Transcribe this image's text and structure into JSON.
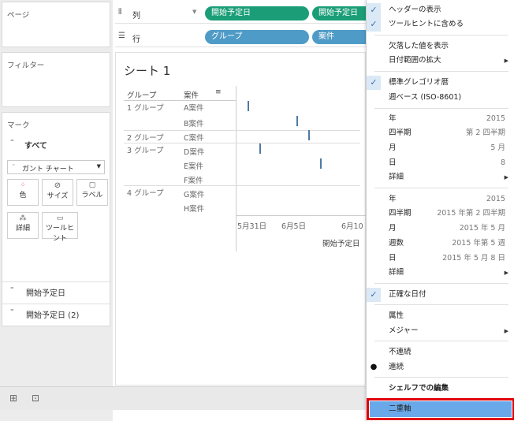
{
  "left": {
    "pages_title": "ページ",
    "filters_title": "フィルター",
    "marks_title": "マーク",
    "marks_all": "すべて",
    "mark_type": "ガント チャート",
    "buttons": {
      "color": "色",
      "size": "サイズ",
      "label": "ラベル",
      "detail": "詳細",
      "tooltip": "ツールヒント"
    },
    "field1": "開始予定日",
    "field2": "開始予定日 (2)"
  },
  "shelves": {
    "columns_label": "列",
    "rows_label": "行",
    "col_pill1": "開始予定日",
    "col_pill2": "開始予定日",
    "row_pill1": "グループ",
    "row_pill2": "案件"
  },
  "sheet": {
    "title": "シート 1",
    "header_group": "グループ",
    "header_case": "案件",
    "rows": [
      {
        "group": "1 グループ",
        "case": "A案件"
      },
      {
        "group": "",
        "case": "B案件"
      },
      {
        "group": "2 グループ",
        "case": "C案件"
      },
      {
        "group": "3 グループ",
        "case": "D案件"
      },
      {
        "group": "",
        "case": "E案件"
      },
      {
        "group": "",
        "case": "F案件"
      },
      {
        "group": "4 グループ",
        "case": "G案件"
      },
      {
        "group": "",
        "case": "H案件"
      }
    ],
    "axis_ticks": [
      "5月31日",
      "6月5日",
      "6月10"
    ],
    "axis_title": "開始予定日"
  },
  "menu": {
    "show_header": "ヘッダーの表示",
    "include_tooltip": "ツールヒントに含める",
    "show_missing": "欠落した値を表示",
    "extend_date": "日付範囲の拡大",
    "gregorian": "標準グレゴリオ暦",
    "iso_week": "週ベース (ISO-8601)",
    "year": "年",
    "year_val": "2015",
    "quarter": "四半期",
    "quarter_val": "第 2 四半期",
    "month": "月",
    "month_val": "5 月",
    "day": "日",
    "day_val": "8",
    "more": "詳細",
    "year2": "年",
    "year2_val": "2015",
    "quarter2": "四半期",
    "quarter2_val": "2015 年第 2 四半期",
    "month2": "月",
    "month2_val": "2015 年 5 月",
    "week2": "週数",
    "week2_val": "2015 年第 5 週",
    "day2": "日",
    "day2_val": "2015 年 5 月 8 日",
    "more2": "詳細",
    "exact_date": "正確な日付",
    "attribute": "属性",
    "measure": "メジャー",
    "discrete": "不連続",
    "continuous": "連続",
    "edit_shelf": "シェルフでの編集",
    "dual_axis": "二重軸"
  }
}
